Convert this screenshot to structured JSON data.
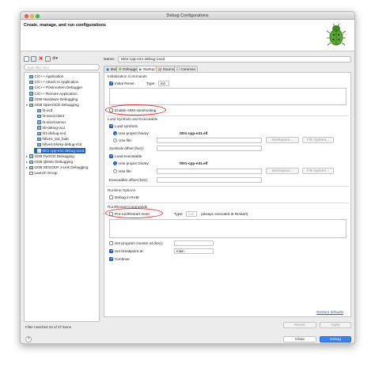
{
  "window": {
    "title": "Debug Configurations"
  },
  "header": {
    "title": "Create, manage, and run configurations"
  },
  "left": {
    "filter_placeholder": "type filter text",
    "status": "Filter matched 23 of 37 items",
    "tree": [
      {
        "label": "C/C++ Application",
        "level": 0,
        "icon": "c-file-icon"
      },
      {
        "label": "C/C++ Attach to Application",
        "level": 0,
        "icon": "c-file-icon"
      },
      {
        "label": "C/C++ Postmortem Debugger",
        "level": 0,
        "icon": "c-file-icon"
      },
      {
        "label": "C/C++ Remote Application",
        "level": 0,
        "icon": "c-file-icon"
      },
      {
        "label": "GDB Hardware Debugging",
        "level": 0,
        "icon": "c-file-icon"
      },
      {
        "label": "GDB OpenOCD Debugging",
        "level": 0,
        "icon": "gdb-icon",
        "expanded": true
      },
      {
        "label": "f4-ocd",
        "level": 1,
        "icon": "c-file-icon"
      },
      {
        "label": "f4-oocd-client",
        "level": 1,
        "icon": "c-file-icon"
      },
      {
        "label": "f4-oocd-server",
        "level": 1,
        "icon": "c-file-icon"
      },
      {
        "label": "hb-debug-ocd",
        "level": 1,
        "icon": "c-file-icon"
      },
      {
        "label": "hf1-debug-ocd",
        "level": 1,
        "icon": "c-file-icon"
      },
      {
        "label": "hifive1_led_fade",
        "level": 1,
        "icon": "c-file-icon"
      },
      {
        "label": "hifive1-blinky-debug-ocd",
        "level": 1,
        "icon": "c-file-icon"
      },
      {
        "label": "t001-cpp-e31-debug-oocd",
        "level": 1,
        "icon": "c-file-icon",
        "selected": true
      },
      {
        "label": "GDB PyOCD Debugging",
        "level": 0,
        "icon": "gdb-icon",
        "collapsed": true
      },
      {
        "label": "GDB QEMU Debugging",
        "level": 0,
        "icon": "gdb-icon",
        "collapsed": true
      },
      {
        "label": "GDB SEGGER J-Link Debugging",
        "level": 0,
        "icon": "gdb-icon",
        "collapsed": true
      },
      {
        "label": "Launch Group",
        "level": 0,
        "icon": "launch-group-icon"
      }
    ]
  },
  "right": {
    "name_label": "Name:",
    "name_value": "t001-cpp-e31-debug-oocd",
    "tabs": [
      "Main",
      "Debugger",
      "Startup",
      "Source",
      "Common"
    ],
    "active_tab": "Startup",
    "init": {
      "section": "Initialization Commands",
      "initial_reset": "Initial Reset.",
      "type_label": "Type:",
      "type_value": "init",
      "enable_arm": "Enable ARM semihosting"
    },
    "load": {
      "section": "Load Symbols and Executable",
      "load_symbols": "Load symbols",
      "use_project_binary": "Use project binary:",
      "binary_value": "t001-cpp-e31.elf",
      "use_file": "Use file:",
      "workspace_btn": "Workspace...",
      "filesystem_btn": "File System...",
      "symbols_offset": "Symbols offset (hex):",
      "load_executable": "Load executable",
      "use_project_binary2": "Use project binary:",
      "binary_value2": "t001-cpp-e31.elf",
      "use_file2": "Use file:",
      "workspace_btn2": "Workspace...",
      "filesystem_btn2": "File System...",
      "exec_offset": "Executable offset (hex):"
    },
    "runtime": {
      "section": "Runtime Options",
      "debug_in_ram": "Debug in RAM"
    },
    "run": {
      "section": "Run/Restart Commands",
      "pre_run": "Pre-run/Restart reset",
      "type_label": "Type:",
      "type_value": "halt",
      "always_note": "(always executed at Restart)",
      "set_pc": "Set program counter at (hex):",
      "set_bp": "Set breakpoint at:",
      "bp_value": "main",
      "continue": "Continue"
    },
    "restore_defaults": "Restore defaults",
    "revert": "Revert",
    "apply": "Apply"
  },
  "footer": {
    "help": "?",
    "close": "Close",
    "debug": "Debug"
  }
}
